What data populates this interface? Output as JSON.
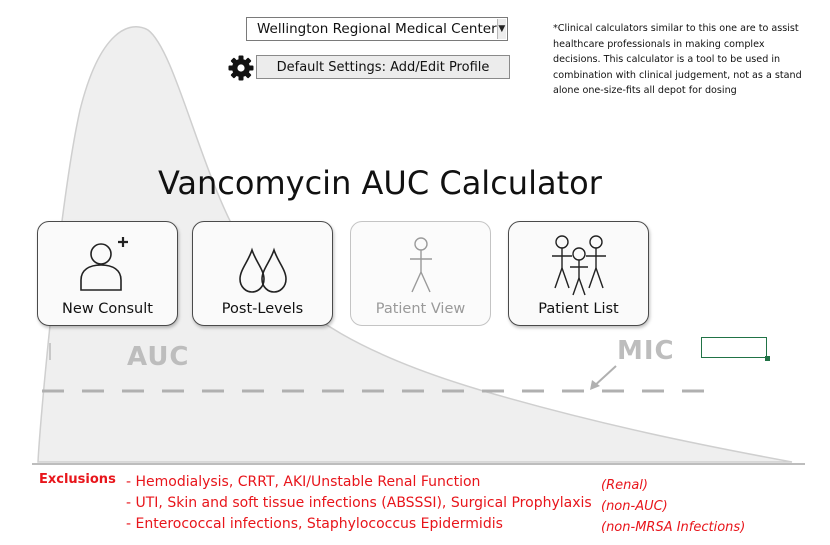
{
  "header": {
    "hospital_selected": "Wellington Regional Medical Center",
    "default_settings_label": "Default Settings: Add/Edit Profile",
    "disclaimer": "*Clinical calculators similar to this one are to assist healthcare professionals in making complex decisions. This calculator is a tool to be used in combination with clinical judgement, not as a stand alone one-size-fits all depot for dosing"
  },
  "main": {
    "title": "Vancomycin AUC Calculator",
    "tiles": [
      {
        "label": "New Consult",
        "icon": "add-user-icon",
        "enabled": true
      },
      {
        "label": "Post-Levels",
        "icon": "droplets-icon",
        "enabled": true
      },
      {
        "label": "Patient View",
        "icon": "stick-figure-icon",
        "enabled": false
      },
      {
        "label": "Patient List",
        "icon": "group-icon",
        "enabled": true
      }
    ]
  },
  "graphic": {
    "auc_label": "AUC",
    "mic_label": "MIC",
    "mic_value": ""
  },
  "exclusions": {
    "heading": "Exclusions",
    "items": [
      "- Hemodialysis, CRRT, AKI/Unstable Renal Function",
      "- UTI, Skin and soft tissue infections (ABSSSI), Surgical Prophylaxis",
      "- Enterococcal infections, Staphylococcus Epidermidis"
    ],
    "categories": [
      "(Renal)",
      "(non-AUC)",
      "(non-MRSA Infections)"
    ]
  },
  "colors": {
    "exclusion_text": "#e8151b",
    "curve_fill": "#efefef",
    "selected_cell_border": "#217346"
  }
}
